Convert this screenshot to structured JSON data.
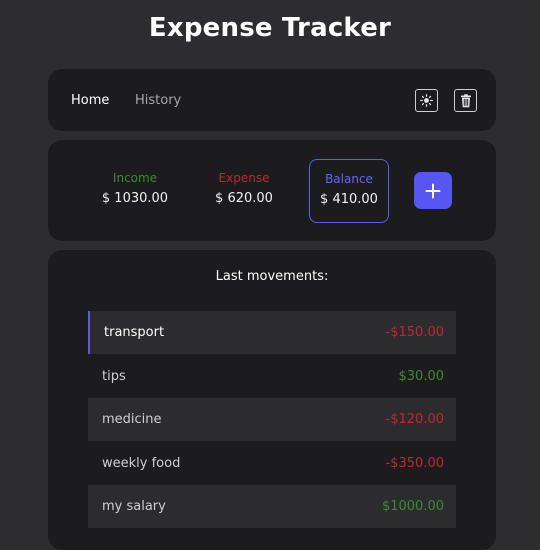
{
  "title": "Expense Tracker",
  "nav": {
    "home_label": "Home",
    "history_label": "History",
    "theme_icon": "sun-icon",
    "clear_icon": "trash-icon"
  },
  "summary": {
    "income_label": "Income",
    "income_value": "$ 1030.00",
    "expense_label": "Expense",
    "expense_value": "$ 620.00",
    "balance_label": "Balance",
    "balance_value": "$ 410.00",
    "add_icon": "plus-icon"
  },
  "movements": {
    "title": "Last movements:",
    "items": [
      {
        "name": "transport",
        "amount": "-$150.00",
        "type": "expense"
      },
      {
        "name": "tips",
        "amount": "$30.00",
        "type": "income"
      },
      {
        "name": "medicine",
        "amount": "-$120.00",
        "type": "expense"
      },
      {
        "name": "weekly food",
        "amount": "-$350.00",
        "type": "expense"
      },
      {
        "name": "my salary",
        "amount": "$1000.00",
        "type": "income"
      }
    ]
  },
  "colors": {
    "background": "#2d2d2f",
    "card": "#1c1c1e",
    "accent": "#5656f2",
    "income": "#3d8a2e",
    "expense": "#c0282d"
  }
}
